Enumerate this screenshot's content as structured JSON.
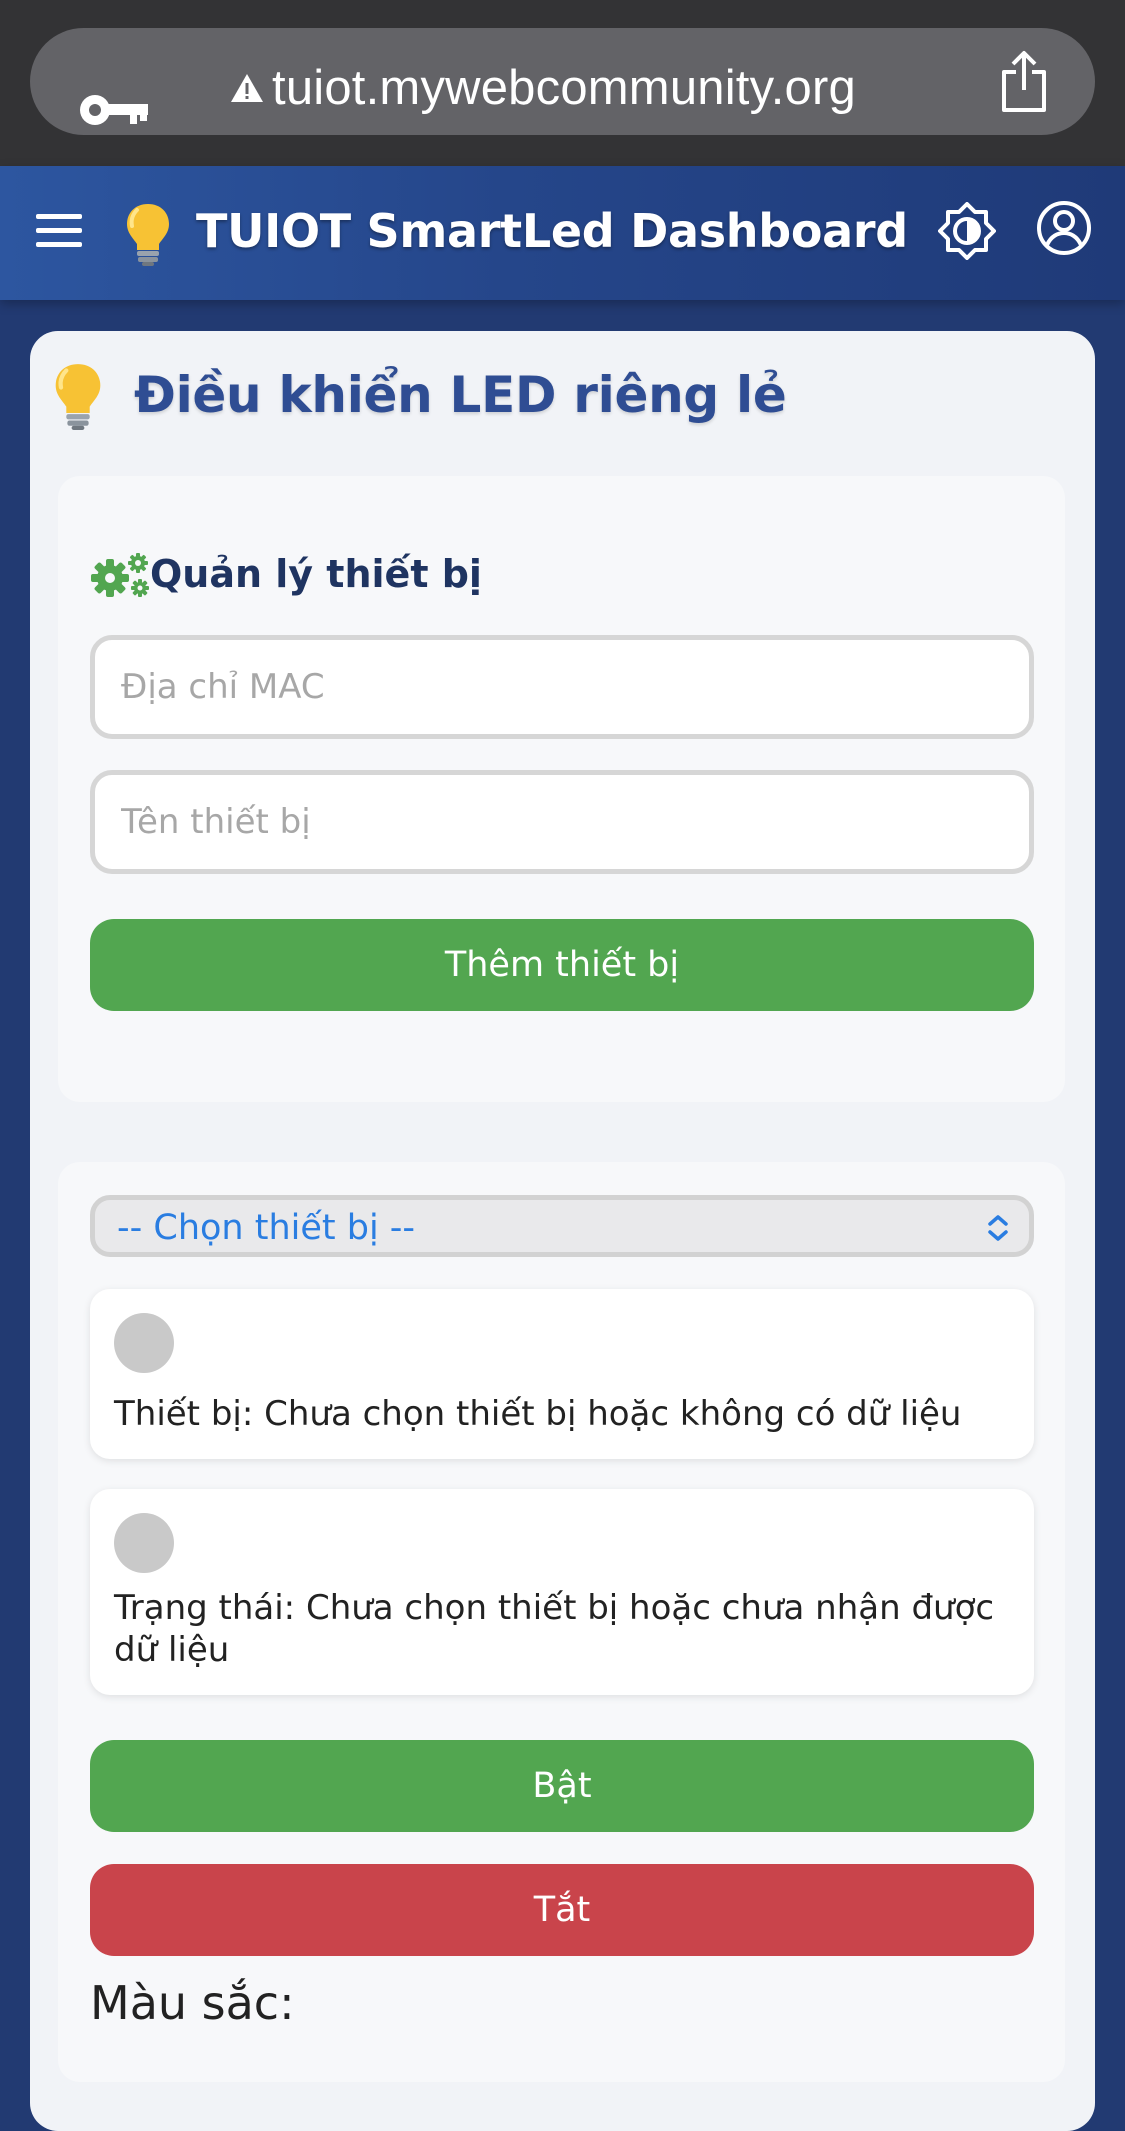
{
  "browser": {
    "url": "tuiot.mywebcommunity.org",
    "left_icon": "key-icon",
    "security_icon": "warning-triangle-icon",
    "right_icon": "share-icon"
  },
  "header": {
    "title": "TUIOT SmartLed Dashboard",
    "menu_icon": "hamburger-menu-icon",
    "logo_icon": "lightbulb-icon",
    "theme_icon": "brightness-icon",
    "account_icon": "account-circle-icon",
    "gradient": [
      "#2d56a0",
      "#1f3a78"
    ]
  },
  "page": {
    "title": "Điều khiển LED riêng lẻ",
    "title_icon": "lightbulb-icon",
    "title_color": "#2f4d93"
  },
  "device_management": {
    "title": "Quản lý thiết bị",
    "icon": "gears-icon",
    "mac_input": {
      "placeholder": "Địa chỉ MAC",
      "value": ""
    },
    "name_input": {
      "placeholder": "Tên thiết bị",
      "value": ""
    },
    "add_button": "Thêm thiết bị"
  },
  "control": {
    "select": {
      "selected": "-- Chọn thiết bị --"
    },
    "device_info": "Thiết bị: Chưa chọn thiết bị hoặc không có dữ liệu",
    "status_info": "Trạng thái: Chưa chọn thiết bị hoặc chưa nhận được dữ liệu",
    "on_button": "Bật",
    "off_button": "Tắt",
    "color_label": "Màu sắc:"
  },
  "colors": {
    "green": "#52a650",
    "red": "#c9444b",
    "select_text": "#2a7de1",
    "indicator_gray": "#c9c9c9"
  }
}
